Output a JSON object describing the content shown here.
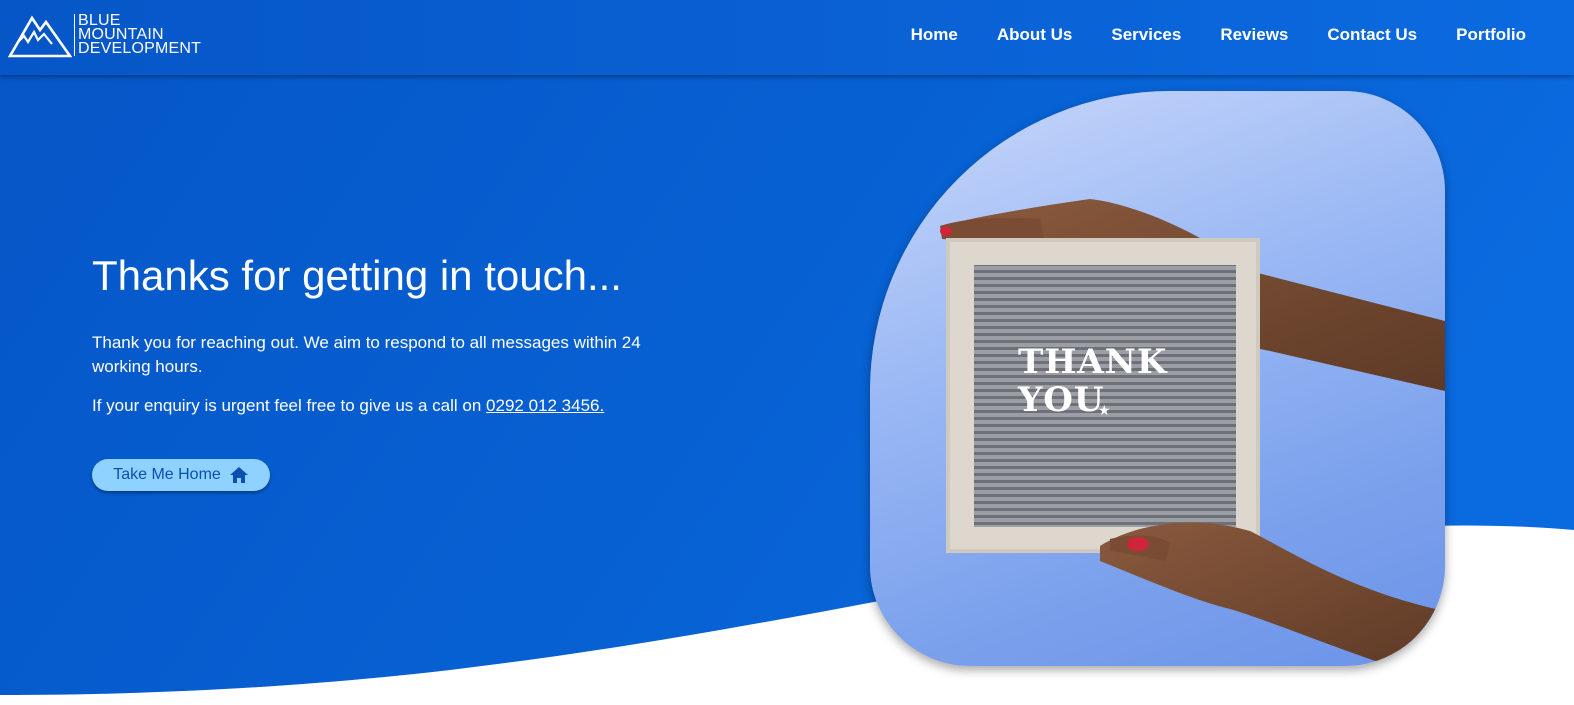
{
  "header": {
    "logo": {
      "line1": "BLUE",
      "line2": "MOUNTAIN",
      "line3": "DEVELOPMENT",
      "icon": "mountain-logo-icon"
    },
    "nav": [
      {
        "label": "Home"
      },
      {
        "label": "About Us"
      },
      {
        "label": "Services"
      },
      {
        "label": "Reviews"
      },
      {
        "label": "Contact Us"
      },
      {
        "label": "Portfolio"
      }
    ]
  },
  "hero": {
    "title": "Thanks for getting in touch...",
    "paragraph1": "Thank you for reaching out. We aim to respond to all messages within 24 working hours.",
    "paragraph2_prefix": "If your enquiry is urgent feel free to give us a call on ",
    "phone": "0292 012 3456.",
    "button_label": "Take Me Home",
    "button_icon": "home-icon"
  },
  "photo": {
    "board_line1": "THANK",
    "board_line2": "YOU"
  },
  "colors": {
    "primary_blue": "#0656c7",
    "button_bg": "#8fd2ff",
    "button_text": "#0b4fb3"
  }
}
